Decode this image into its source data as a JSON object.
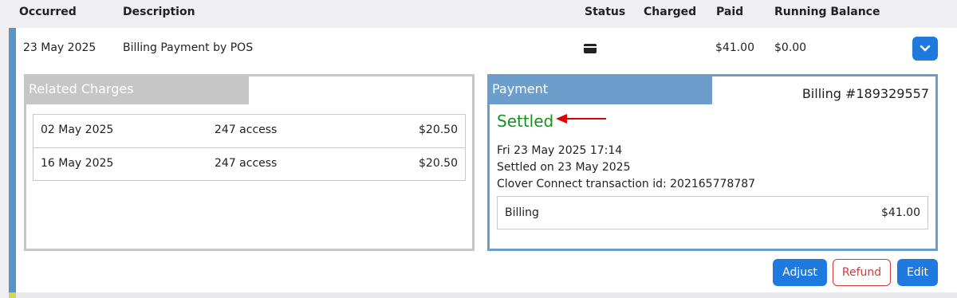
{
  "table_header": {
    "occurred": "Occurred",
    "description": "Description",
    "status": "Status",
    "charged": "Charged",
    "paid": "Paid",
    "running_balance": "Running Balance"
  },
  "transaction": {
    "date": "23 May 2025",
    "description": "Billing Payment by POS",
    "status_icon": "credit-card-icon",
    "charged": "",
    "paid": "$41.00",
    "running_balance": "$0.00"
  },
  "related_charges": {
    "title": "Related Charges",
    "rows": [
      {
        "date": "02 May 2025",
        "description": "247 access",
        "amount": "$20.50"
      },
      {
        "date": "16 May 2025",
        "description": "247 access",
        "amount": "$20.50"
      }
    ]
  },
  "payment": {
    "title": "Payment",
    "billing_number": "Billing #189329557",
    "status": "Settled",
    "status_color": "#14921f",
    "datetime": "Fri 23 May 2025 17:14",
    "settled_on": "Settled on 23 May 2025",
    "transaction_id": "Clover Connect transaction id: 202165778787",
    "billing_label": "Billing",
    "billing_amount": "$41.00"
  },
  "actions": {
    "adjust": "Adjust",
    "refund": "Refund",
    "edit": "Edit"
  },
  "colors": {
    "primary": "#1f7ae0",
    "danger": "#d23a3a",
    "accent": "#5a93c6",
    "payment_panel": "#6c9ecc",
    "related_panel": "#c6c6c6"
  }
}
